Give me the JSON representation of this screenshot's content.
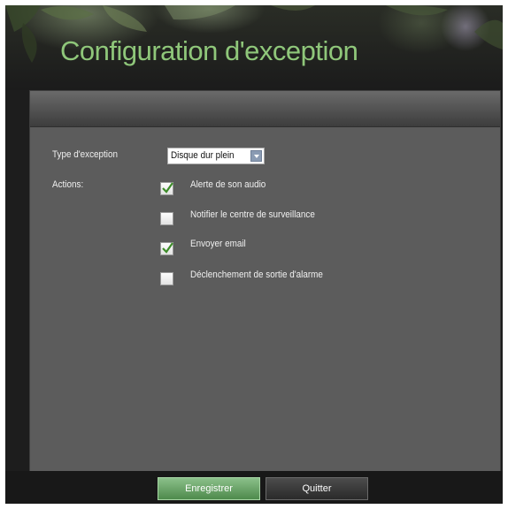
{
  "window": {
    "title": "Configuration d'exception"
  },
  "form": {
    "exception_type_label": "Type d'exception",
    "exception_type_value": "Disque dur plein",
    "actions_label": "Actions:",
    "actions": [
      {
        "label": "Alerte de son audio",
        "checked": true
      },
      {
        "label": "Notifier le centre de surveillance",
        "checked": false
      },
      {
        "label": "Envoyer email",
        "checked": true
      },
      {
        "label": "Déclenchement de sortie d'alarme",
        "checked": false
      }
    ]
  },
  "buttons": {
    "save_label": "Enregistrer",
    "quit_label": "Quitter"
  },
  "colors": {
    "title": "#8fc77a",
    "panel": "#5c5c5c",
    "check": "#3e8c2a",
    "save_button": "#6ea66c"
  },
  "icons": {
    "dropdown": "chevron-down-icon",
    "check": "checkmark-icon"
  }
}
